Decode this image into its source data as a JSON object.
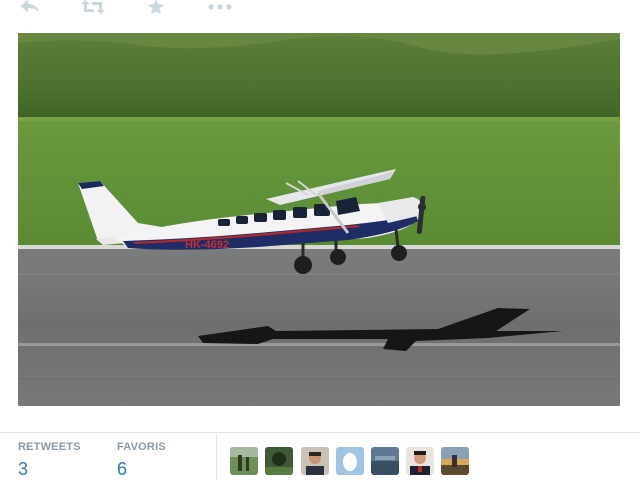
{
  "actions": {
    "reply_icon": "reply-icon",
    "retweet_icon": "retweet-icon",
    "favorite_icon": "star-icon",
    "more_icon": "more-icon",
    "icon_color": "#ccd6dd"
  },
  "photo": {
    "aircraft_registration": "HK-4692"
  },
  "stats": {
    "retweets_label": "RETWEETS",
    "retweets_count": "3",
    "favorites_label": "FAVORIS",
    "favorites_count": "6",
    "label_color": "#8899a6",
    "value_color": "#2b7bb9"
  },
  "avatars": [
    {
      "icon": "avatar-landscape"
    },
    {
      "icon": "avatar-landscape-dark"
    },
    {
      "icon": "avatar-man-portrait"
    },
    {
      "icon": "avatar-default-egg"
    },
    {
      "icon": "avatar-landscape-water"
    },
    {
      "icon": "avatar-man-suit"
    },
    {
      "icon": "avatar-landscape-sunset"
    }
  ]
}
